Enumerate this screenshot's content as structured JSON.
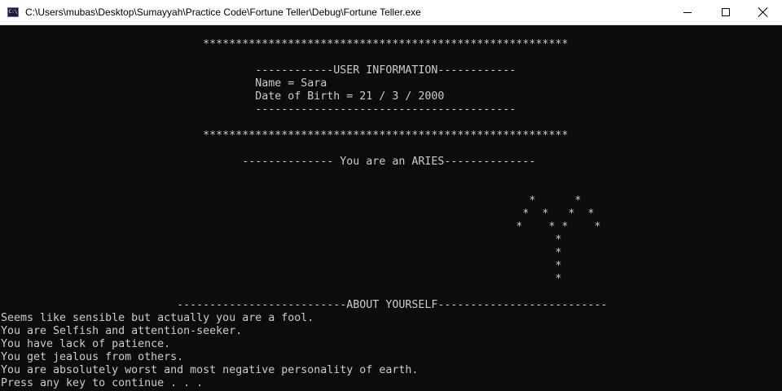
{
  "window": {
    "title": "C:\\Users\\mubas\\Desktop\\Sumayyah\\Practice Code\\Fortune Teller\\Debug\\Fortune Teller.exe",
    "icon_name": "console-app-icon",
    "icon_text": "C:\\",
    "controls": {
      "minimize": "minimize-icon",
      "maximize": "maximize-icon",
      "close": "close-icon"
    }
  },
  "console": {
    "text_color": "#cccccc",
    "background": "#0c0c0c",
    "lines": [
      "                               ********************************************************",
      "",
      "                                       ------------USER INFORMATION------------",
      "                                       Name = Sara",
      "                                       Date of Birth = 21 / 3 / 2000",
      "                                       ----------------------------------------",
      "",
      "                               ********************************************************",
      "",
      "                                     -------------- You are an ARIES--------------",
      "",
      "",
      "                                                                                 *      *",
      "                                                                                *  *   *  *",
      "                                                                               *    * *    *",
      "                                                                                     *",
      "                                                                                     *",
      "                                                                                     *",
      "                                                                                     *",
      "",
      "                           --------------------------ABOUT YOURSELF--------------------------",
      "Seems like sensible but actually you are a fool.",
      "You are Selfish and attention-seeker.",
      "You have lack of patience.",
      "You get jealous from others.",
      "You are absolutely worst and most negative personality of earth.",
      "Press any key to continue . . ."
    ]
  }
}
